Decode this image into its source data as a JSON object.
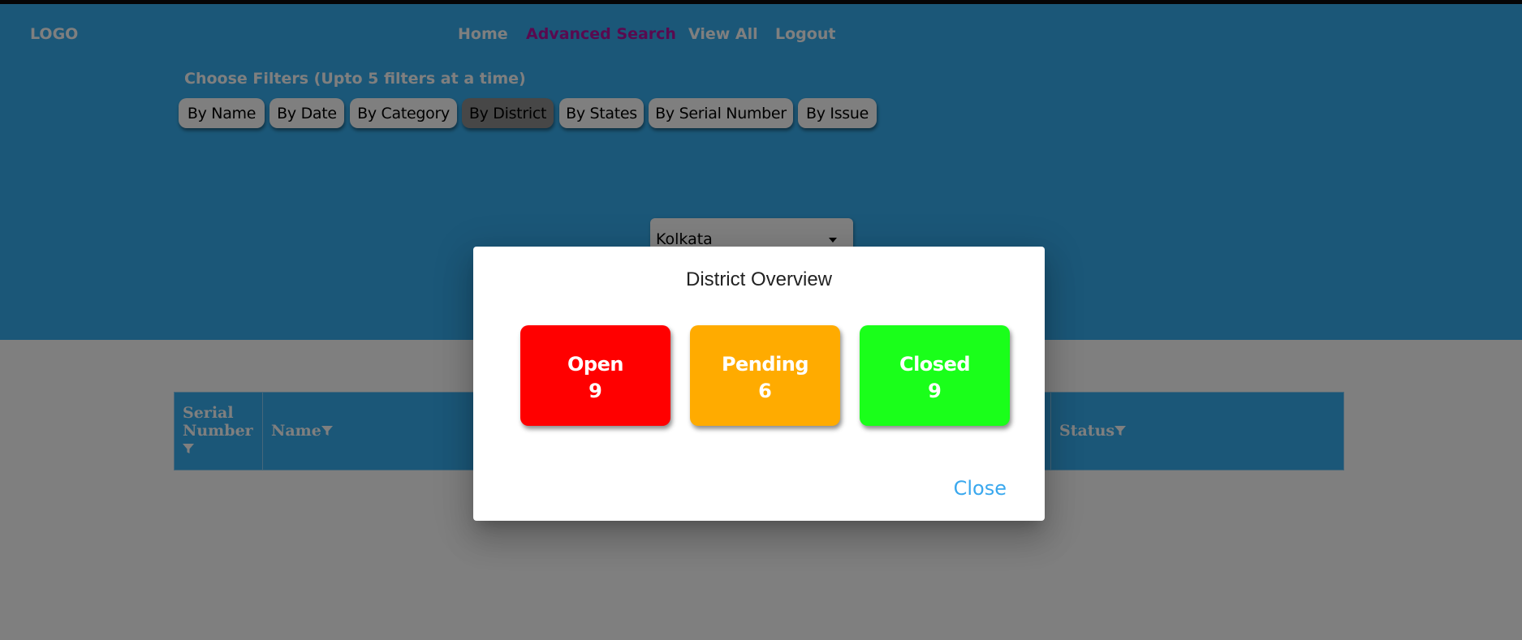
{
  "header": {
    "logo": "LOGO",
    "nav": [
      {
        "label": "Home",
        "active": false
      },
      {
        "label": "Advanced Search",
        "active": true
      },
      {
        "label": "View All",
        "active": false
      },
      {
        "label": "Logout",
        "active": false
      }
    ]
  },
  "filters": {
    "title": "Choose Filters (Upto 5 filters at a time)",
    "buttons": [
      {
        "label": "By Name",
        "active": false
      },
      {
        "label": "By Date",
        "active": false
      },
      {
        "label": "By Category",
        "active": false
      },
      {
        "label": "By District",
        "active": true
      },
      {
        "label": "By States",
        "active": false
      },
      {
        "label": "By Serial Number",
        "active": false
      },
      {
        "label": "By Issue",
        "active": false
      }
    ],
    "district_select": {
      "value": "Kolkata"
    }
  },
  "table": {
    "columns": [
      {
        "label": "Serial Number",
        "icon": "filter-icon"
      },
      {
        "label": "Name",
        "icon": "filter-icon"
      },
      {
        "label": "Status",
        "icon": "filter-icon"
      }
    ]
  },
  "modal": {
    "title": "District Overview",
    "cards": [
      {
        "label": "Open",
        "count": "9",
        "color": "#ff0000"
      },
      {
        "label": "Pending",
        "count": "6",
        "color": "#ffab00"
      },
      {
        "label": "Closed",
        "count": "9",
        "color": "#1aff1a"
      }
    ],
    "close_label": "Close"
  },
  "colors": {
    "header_bg": "#37aff0",
    "active_nav": "#b2149f",
    "close_link": "#3aa8ee"
  }
}
